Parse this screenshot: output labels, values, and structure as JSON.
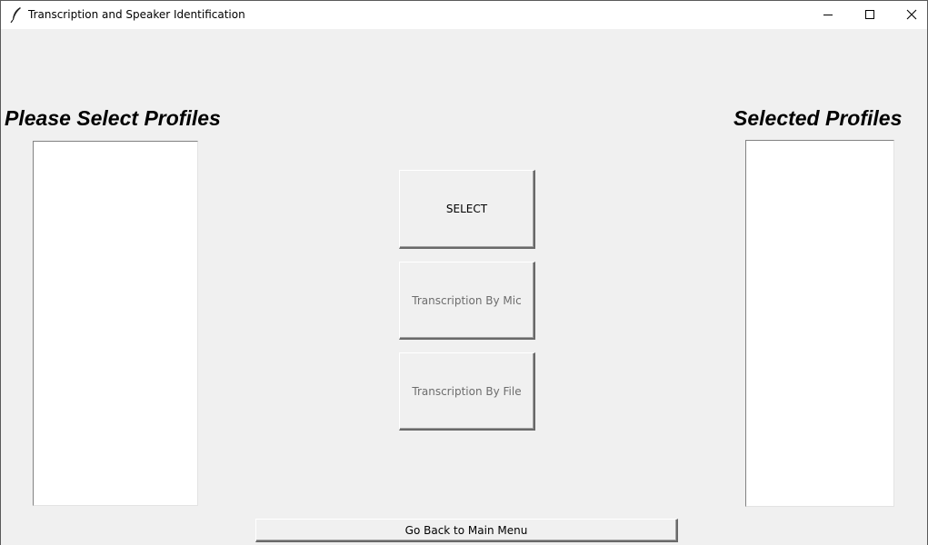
{
  "window": {
    "title": "Transcription and Speaker Identification",
    "icon": "feather-icon",
    "controls": [
      "minimize-icon",
      "maximize-icon",
      "close-icon"
    ]
  },
  "left_panel": {
    "heading": "Please Select Profiles",
    "items": []
  },
  "right_panel": {
    "heading": "Selected Profiles",
    "items": []
  },
  "actions": {
    "select_label": "SELECT",
    "mic_label": "Transcription By Mic",
    "file_label": "Transcription By File",
    "back_label": "Go Back to Main Menu"
  },
  "colors": {
    "window_bg": "#f0f0f0",
    "listbox_bg": "#ffffff",
    "disabled_text": "#6d6d6d"
  }
}
